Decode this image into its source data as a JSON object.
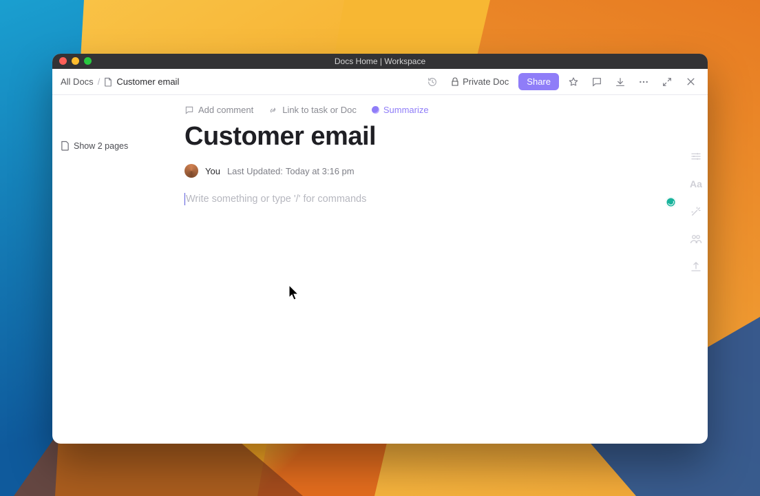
{
  "window": {
    "title": "Docs Home | Workspace"
  },
  "breadcrumb": {
    "root": "All Docs",
    "sep": "/",
    "current": "Customer email"
  },
  "toolbar": {
    "private_label": "Private Doc",
    "share_label": "Share"
  },
  "sidebar": {
    "show_pages_label": "Show 2 pages"
  },
  "actions": {
    "add_comment": "Add comment",
    "link_doc": "Link to task or Doc",
    "summarize": "Summarize"
  },
  "doc": {
    "title": "Customer email",
    "author": "You",
    "last_updated_prefix": "Last Updated:",
    "last_updated_value": "Today at 3:16 pm",
    "editor_placeholder": "Write something or type '/' for commands"
  },
  "icons": {
    "history": "history-icon",
    "lock": "lock-icon",
    "star": "star-outline-icon",
    "comment": "comment-icon",
    "download": "download-arrow-icon",
    "more": "more-horizontal-icon",
    "collapse": "collapse-icon",
    "close": "close-icon",
    "page": "page-outline-icon",
    "comment_small": "comment-outline-icon",
    "link_small": "link-diagonal-icon",
    "rail_settings": "sliders-icon",
    "rail_text": "text-aa-icon",
    "rail_wand": "wand-icon",
    "rail_people": "people-icon",
    "rail_upload": "upload-icon"
  }
}
